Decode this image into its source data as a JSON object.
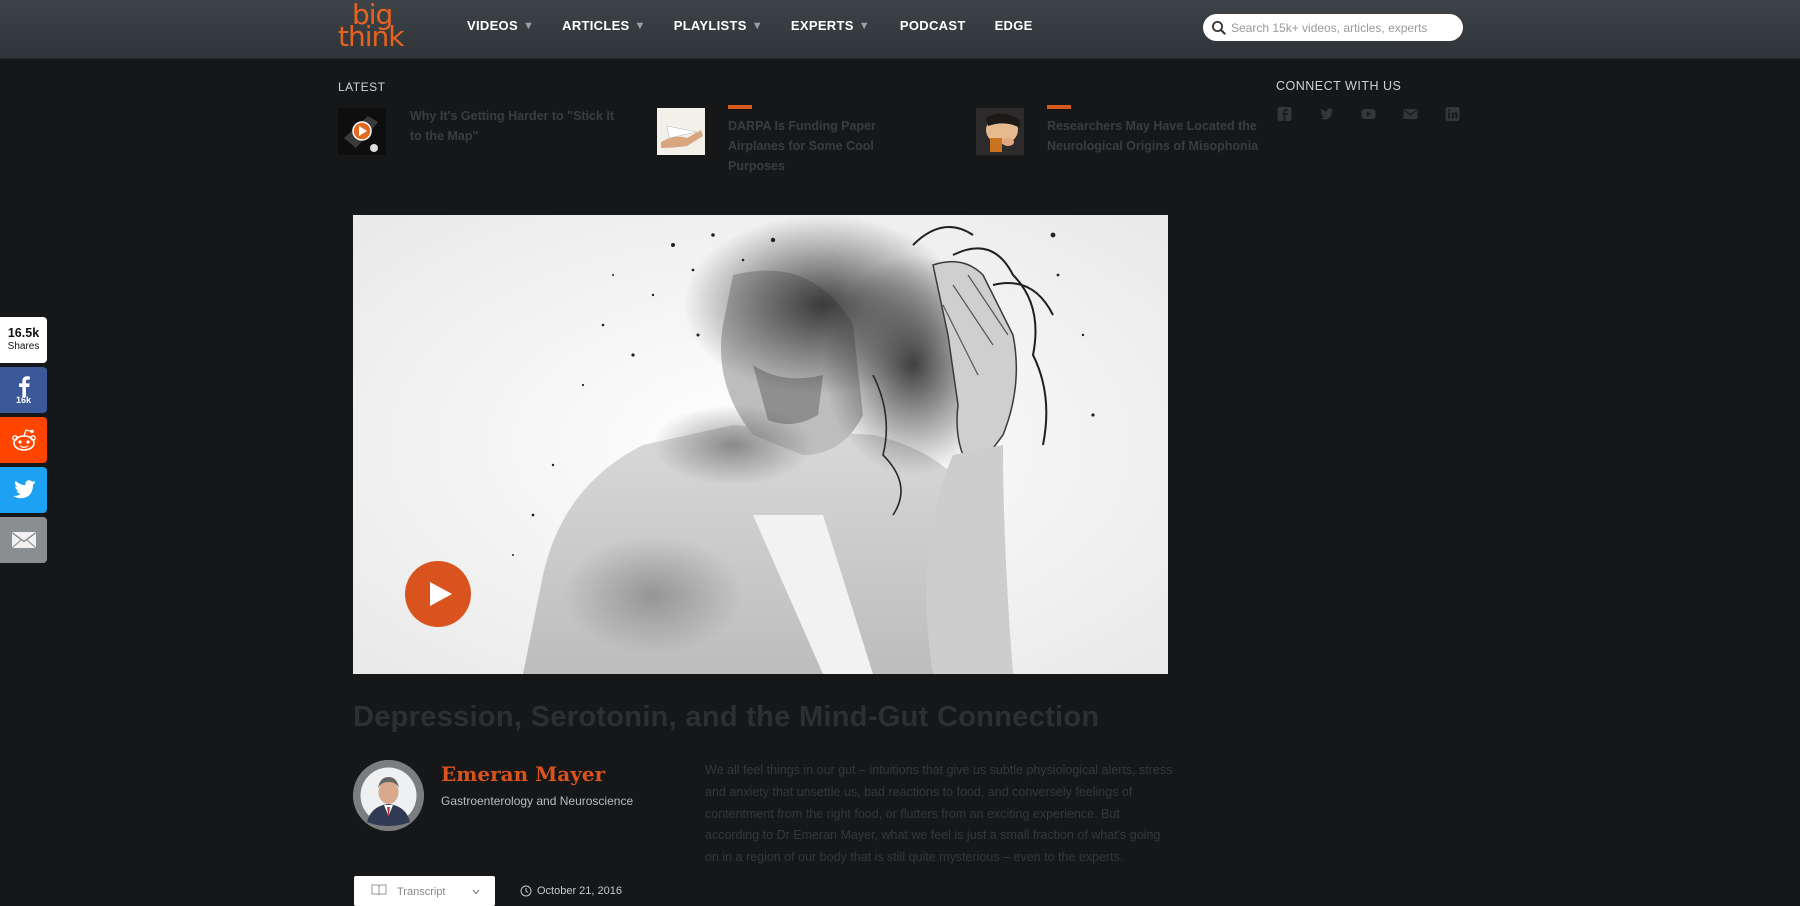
{
  "header": {
    "logo": {
      "line1": "big",
      "line2": "think"
    },
    "nav": [
      {
        "label": "VIDEOS",
        "dropdown": true
      },
      {
        "label": "ARTICLES",
        "dropdown": true
      },
      {
        "label": "PLAYLISTS",
        "dropdown": true
      },
      {
        "label": "EXPERTS",
        "dropdown": true
      },
      {
        "label": "PODCAST",
        "dropdown": false
      },
      {
        "label": "EDGE",
        "dropdown": false
      }
    ],
    "search": {
      "placeholder": "Search 15k+ videos, articles, experts",
      "value": ""
    }
  },
  "latest": {
    "label": "LATEST",
    "items": [
      {
        "title": "Why It's Getting Harder to \"Stick It to the Map\"",
        "has_play": true
      },
      {
        "title": "DARPA Is Funding Paper Airplanes for Some Cool Purposes",
        "has_play": false
      },
      {
        "title": "Researchers May Have Located the Neurological Origins of Misophonia",
        "has_play": false
      }
    ]
  },
  "connect": {
    "label": "CONNECT WITH US",
    "icons": [
      "facebook-icon",
      "twitter-icon",
      "youtube-icon",
      "email-icon",
      "linkedin-icon"
    ]
  },
  "share": {
    "count": "16.5k",
    "count_label": "Shares",
    "facebook_count": "16k"
  },
  "article": {
    "title": "Depression, Serotonin, and the Mind-Gut Connection",
    "author": {
      "name": "Emeran Mayer",
      "role": "Gastroenterology and Neuroscience"
    },
    "summary": "We all feel things in our gut – intuitions that give us subtle physiological alerts, stress and anxiety that unsettle us, bad reactions to food, and conversely feelings of contentment from the right food, or flutters from an exciting experience. But according to Dr Emeran Mayer, what we feel is just a small fraction of what's going on in a region of our body that is still quite mysterious – even to the experts.",
    "transcript_label": "Transcript",
    "date": "October 21, 2016"
  },
  "colors": {
    "accent": "#d9531e",
    "header_bg": "#353a3e",
    "page_bg": "#161718"
  }
}
